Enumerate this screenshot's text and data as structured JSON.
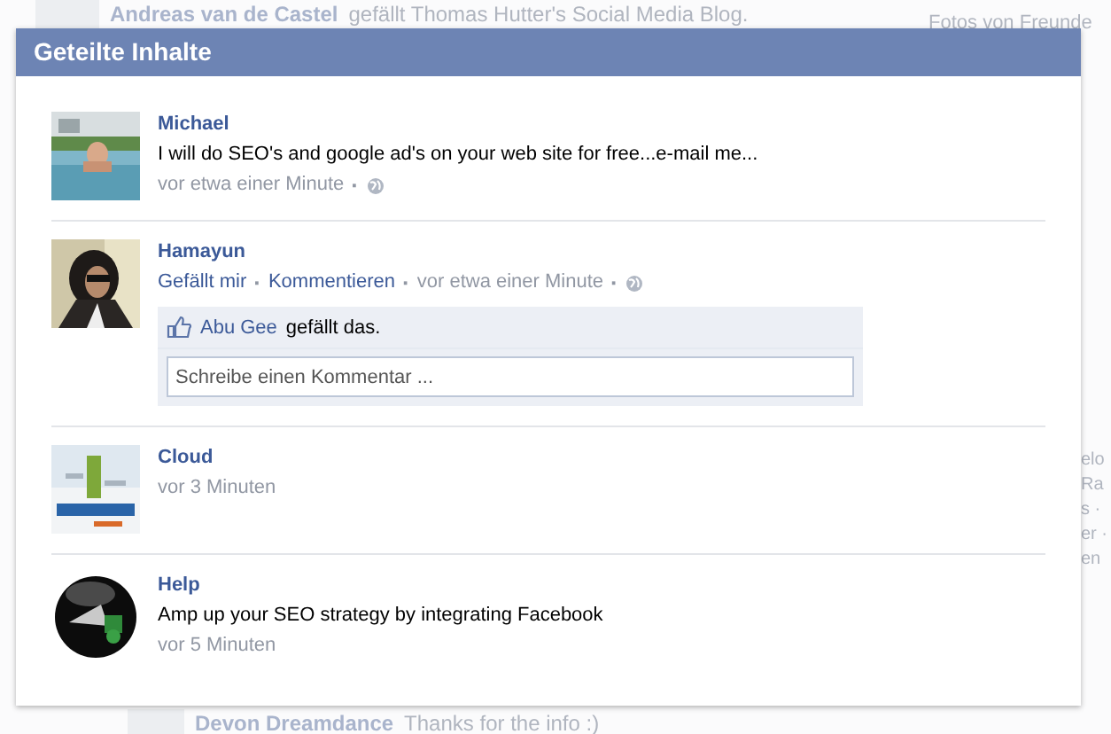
{
  "background": {
    "feed_top": {
      "name": "Andreas van de Castel",
      "text": "gefällt Thomas Hutter's Social Media Blog."
    },
    "sidebar_heading": "Fotos von Freunde",
    "sidebar_fragments": [
      "elo",
      "Ra",
      "s ·",
      "er ·",
      "en"
    ],
    "feed_bottom": {
      "name": "Devon Dreamdance",
      "text": "Thanks for the info :)"
    }
  },
  "dialog": {
    "title": "Geteilte Inhalte",
    "items": [
      {
        "name": "Michael",
        "text": "I will do SEO's and google ad's on your web site for free...e-mail me...",
        "meta": [
          {
            "kind": "time",
            "text": "vor etwa einer Minute"
          },
          {
            "kind": "sep",
            "text": "·"
          }
        ],
        "public": true
      },
      {
        "name": "Hamayun",
        "meta": [
          {
            "kind": "link",
            "text": "Gefällt mir"
          },
          {
            "kind": "sep",
            "text": "·"
          },
          {
            "kind": "link",
            "text": "Kommentieren"
          },
          {
            "kind": "sep",
            "text": "·"
          },
          {
            "kind": "time",
            "text": "vor etwa einer Minute"
          },
          {
            "kind": "sep",
            "text": "·"
          }
        ],
        "public": true,
        "likes": {
          "name": "Abu Gee",
          "text": "gefällt das."
        },
        "comment_placeholder": "Schreibe einen Kommentar ..."
      },
      {
        "name": "Cloud",
        "meta": [
          {
            "kind": "time",
            "text": "vor 3 Minuten"
          }
        ],
        "public": false
      },
      {
        "name": "Help",
        "text": "Amp up your SEO strategy by integrating Facebook",
        "meta": [
          {
            "kind": "time",
            "text": "vor 5 Minuten"
          }
        ],
        "public": false
      }
    ]
  }
}
